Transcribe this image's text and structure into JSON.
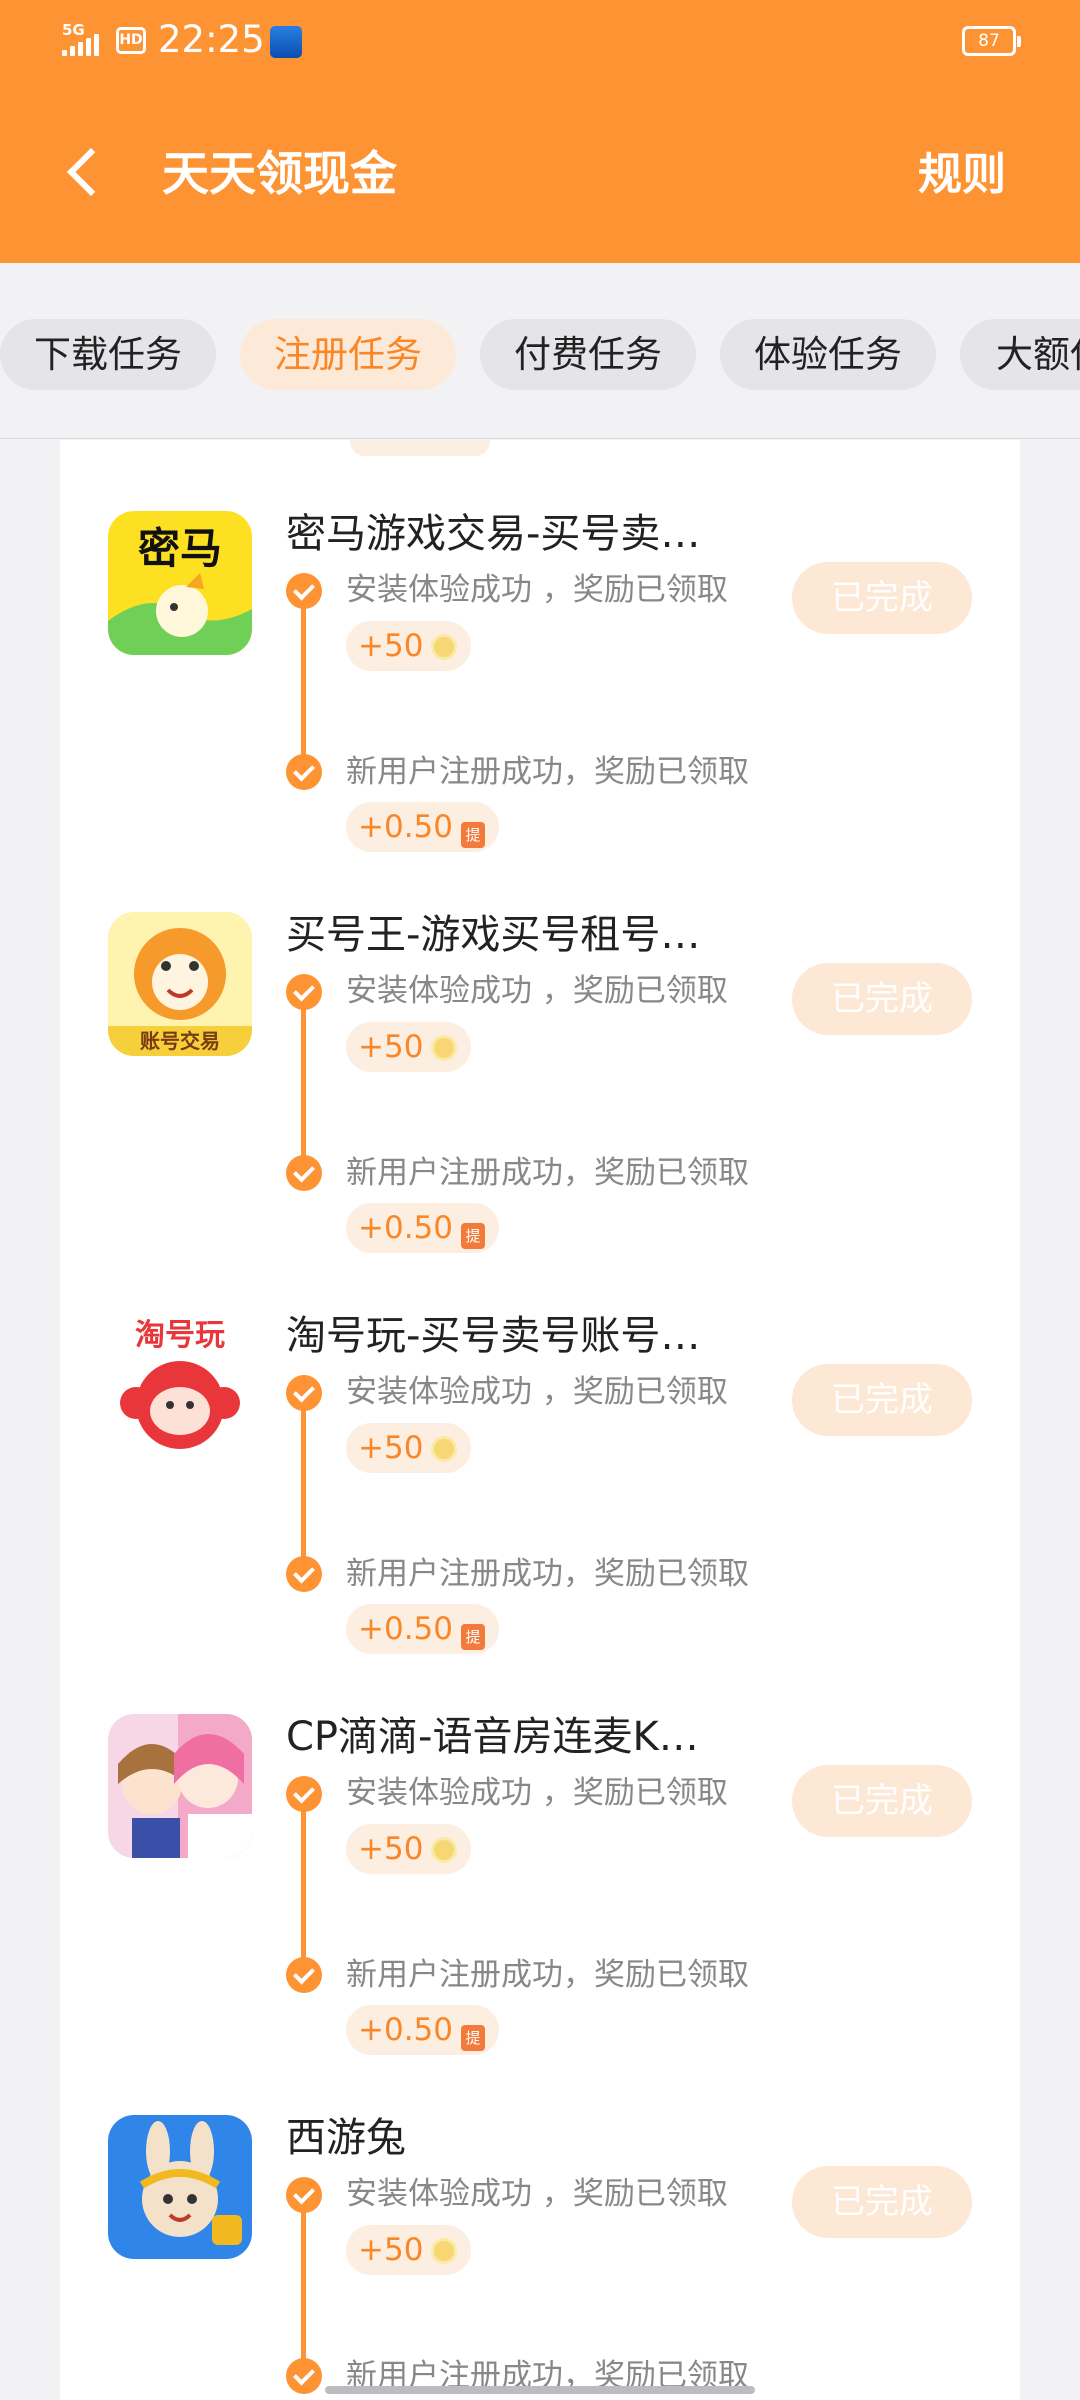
{
  "status": {
    "network": "5G",
    "hd": "HD",
    "time": "22:25",
    "battery": "87"
  },
  "header": {
    "title": "天天领现金",
    "rules": "规则"
  },
  "tabs": [
    {
      "label": "下载任务",
      "active": false
    },
    {
      "label": "注册任务",
      "active": true
    },
    {
      "label": "付费任务",
      "active": false
    },
    {
      "label": "体验任务",
      "active": false
    },
    {
      "label": "大额任务",
      "active": false
    }
  ],
  "items": [
    {
      "name": "密马游戏交易-买号卖…",
      "step1": "安装体验成功 ，奖励已领取",
      "reward1": "+50",
      "step2": "新用户注册成功，奖励已领取",
      "reward2": "+0.50",
      "status": "已完成",
      "icon_text": "密马"
    },
    {
      "name": "买号王-游戏买号租号…",
      "step1": "安装体验成功 ，奖励已领取",
      "reward1": "+50",
      "step2": "新用户注册成功，奖励已领取",
      "reward2": "+0.50",
      "status": "已完成",
      "icon_text": "账号交易"
    },
    {
      "name": "淘号玩-买号卖号账号…",
      "step1": "安装体验成功 ，奖励已领取",
      "reward1": "+50",
      "step2": "新用户注册成功，奖励已领取",
      "reward2": "+0.50",
      "status": "已完成",
      "icon_text": "淘号玩"
    },
    {
      "name": "CP滴滴-语音房连麦K…",
      "step1": "安装体验成功 ，奖励已领取",
      "reward1": "+50",
      "step2": "新用户注册成功，奖励已领取",
      "reward2": "+0.50",
      "status": "已完成",
      "icon_text": ""
    },
    {
      "name": "西游兔",
      "step1": "安装体验成功 ，奖励已领取",
      "reward1": "+50",
      "step2": "新用户注册成功，奖励已领取",
      "reward2": "",
      "status": "已完成",
      "icon_text": ""
    }
  ],
  "cash_badge": "提",
  "colors": {
    "brand": "#fe9334",
    "accent_text": "#f98727",
    "reward_bg": "#fdeee2",
    "done_bg": "#fde7d5"
  }
}
